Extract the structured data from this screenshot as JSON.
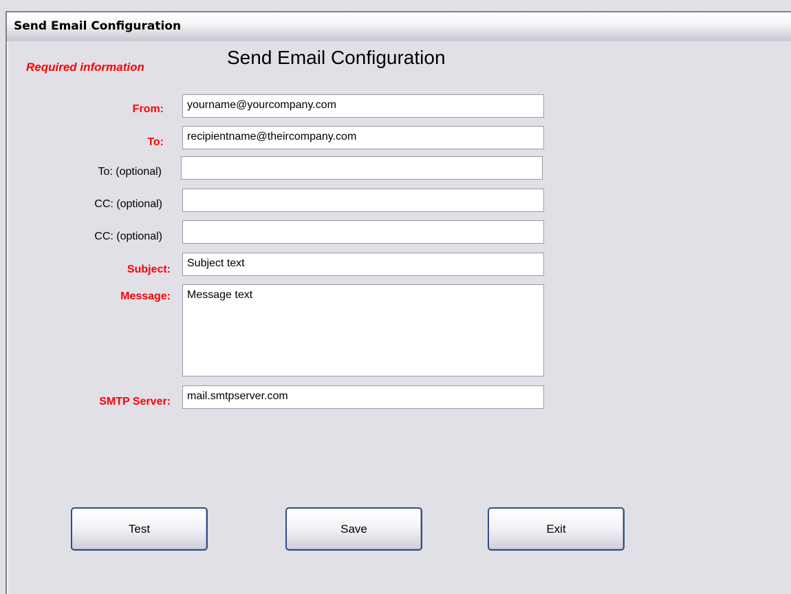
{
  "window": {
    "title": "Send Email Configuration"
  },
  "form": {
    "required_note": "Required information",
    "heading": "Send Email Configuration",
    "fields": [
      {
        "label": "From:",
        "value": "yourname@yourcompany.com",
        "required": true
      },
      {
        "label": "To:",
        "value": "recipientname@theircompany.com",
        "required": true
      },
      {
        "label": "To: (optional)",
        "value": "",
        "required": false
      },
      {
        "label": "CC: (optional)",
        "value": "",
        "required": false
      },
      {
        "label": "CC: (optional)",
        "value": "",
        "required": false
      },
      {
        "label": "Subject:",
        "value": "Subject text",
        "required": true
      },
      {
        "label": "Message:",
        "value": "Message text",
        "required": true
      },
      {
        "label": "SMTP Server:",
        "value": "mail.smtpserver.com",
        "required": true
      }
    ]
  },
  "buttons": {
    "test": "Test",
    "save": "Save",
    "exit": "Exit"
  },
  "colors": {
    "required_label": "#ff0000",
    "background": "#e1e0e6",
    "button_border": "#2b4f8a"
  }
}
